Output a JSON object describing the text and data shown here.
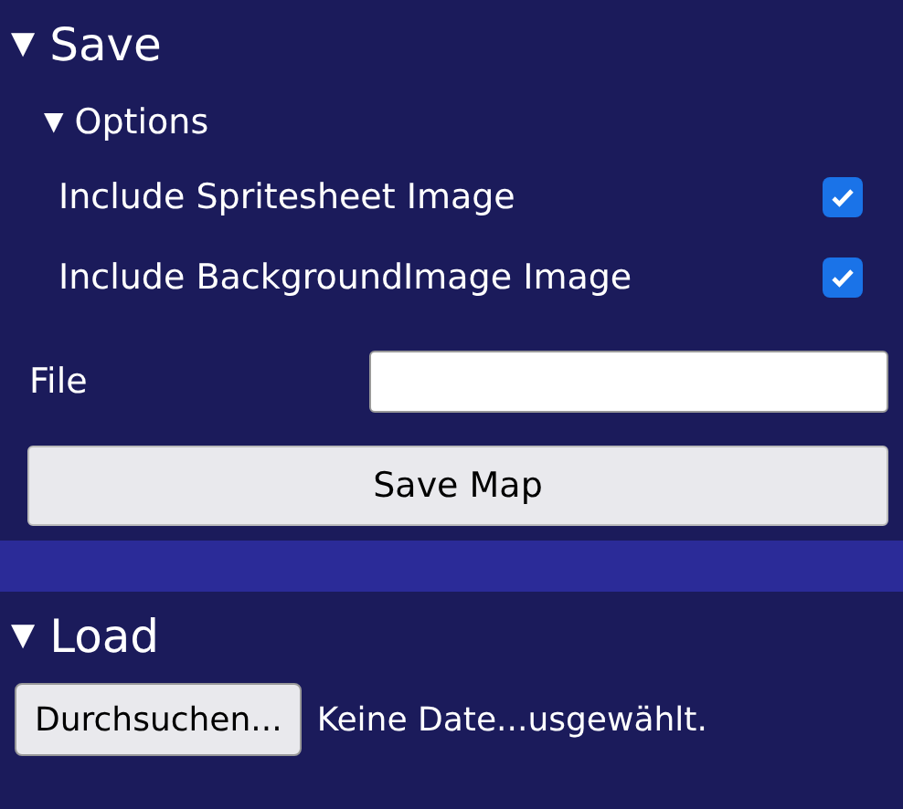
{
  "save": {
    "arrow": "▼",
    "title": "Save",
    "options": {
      "arrow": "▼",
      "title": "Options",
      "items": [
        {
          "label": "Include Spritesheet Image",
          "checked": true
        },
        {
          "label": "Include BackgroundImage Image",
          "checked": true
        }
      ]
    },
    "file": {
      "label": "File"
    },
    "button": "Save Map"
  },
  "load": {
    "arrow": "▼",
    "title": "Load",
    "browse_button": "Durchsuchen...",
    "status": "Keine Date...usgewählt."
  }
}
